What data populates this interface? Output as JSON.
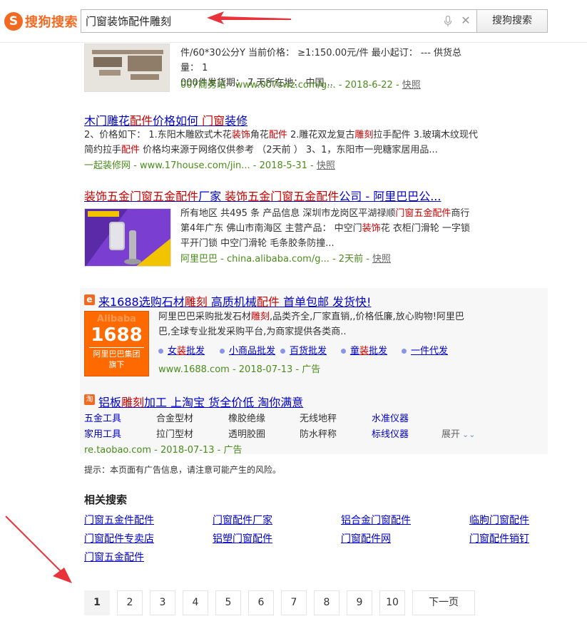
{
  "header": {
    "logo_text": "搜狗搜索",
    "query": "门窗装饰配件雕刻",
    "search_button": "搜狗搜索"
  },
  "result1": {
    "line1": "件/60*30公分Y 当前价格： ≥1:150.00元/件 最小起订： --- 供货总量： 1",
    "line2": "000件发货期： 7 天所在地： 中国...",
    "source": "007商务站 - www.007swz.com/g... - 2018-6-22 - ",
    "snapshot": "快照"
  },
  "result2": {
    "title_parts": [
      "木门雕花",
      "配件",
      "价格如何 ",
      "门窗",
      "装修"
    ],
    "line1_parts": [
      "2、价格如下： 1.东阳木雕欧式木花",
      "装饰",
      "角花",
      "配件",
      " 2.雕花双龙复古",
      "雕刻",
      "拉手",
      "配件",
      " 3.玻璃木纹现代"
    ],
    "line2_parts": [
      "简约拉手",
      "配件",
      " 价格均来源于网络仅供参考 （2天前 ） 3、1，东阳市一兜糖家居用品..."
    ],
    "source": "一起装修网 - www.17house.com/jin... - 2018-5-31 - ",
    "snapshot": "快照"
  },
  "result3": {
    "title_parts": [
      "装饰",
      "五金",
      "门窗",
      "五金",
      "配件",
      "厂家 ",
      "装饰",
      "五金",
      "门窗",
      "五金",
      "配件",
      "公司 - 阿里巴巴公..."
    ],
    "line1_parts": [
      "所有地区 共495 条 产品信息 深圳市龙岗区平湖禄顺",
      "门窗",
      "五金",
      "配件",
      "商行"
    ],
    "line2_parts": [
      "第4年广东 佛山市南海区 主营产品： 中空门",
      "装饰",
      "花 衣柜门滑轮 一字锁"
    ],
    "line3": "平开门锁 中空门滑轮 毛条胶条防撞...",
    "source": "阿里巴巴 - china.alibaba.com/g... - 2天前 - ",
    "snapshot": "快照"
  },
  "ad1": {
    "badge": "e",
    "title_parts": [
      "来1688选购石材",
      "雕刻",
      " 高质机械",
      "配件",
      " 首单包邮 发货快!"
    ],
    "logo_top": "Alibaba",
    "logo_num": "1688",
    "logo_line1": "阿里巴巴集团",
    "logo_line2": "旗下",
    "line1_parts": [
      "阿里巴巴采购批发石材",
      "雕刻",
      ",品类齐全,厂家直销,,价格低廉,放心购物!阿里巴"
    ],
    "line2": "巴,全球专业批发采购平台,为商家提供各类商..",
    "links": [
      {
        "parts": [
          "女",
          "装",
          "批发"
        ]
      },
      {
        "parts": [
          "小商品批发"
        ]
      },
      {
        "parts": [
          "百货批发"
        ]
      },
      {
        "parts": [
          "童",
          "装",
          "批发"
        ]
      },
      {
        "parts": [
          "一件代发"
        ]
      }
    ],
    "source": "www.1688.com - 2018-07-13 - 广告"
  },
  "ad2": {
    "badge": "淘",
    "title_parts": [
      "铝板",
      "雕刻",
      "加工 上淘宝 货全价低 淘你满意"
    ],
    "row1": [
      "五金工具",
      "合金型材",
      "橡胶绝缘",
      "无线地秤",
      "水准仪器"
    ],
    "row2": [
      "家用工具",
      "拉门型材",
      "透明胶圈",
      "防水秤称",
      "标线仪器"
    ],
    "expand": "展开",
    "source": "re.taobao.com - 2018-07-13 - 广告"
  },
  "notice": "提示：本页面有广告信息，请注意可能产生的风险。",
  "related": {
    "title": "相关搜索",
    "items": [
      "门窗五金件配件",
      "门窗配件厂家",
      "铝合金门窗配件",
      "临朐门窗配件",
      "门窗配件专卖店",
      "铝塑门窗配件",
      "门窗配件网",
      "门窗配件销钉",
      "门窗五金配件"
    ]
  },
  "pager": {
    "pages": [
      "1",
      "2",
      "3",
      "4",
      "5",
      "6",
      "7",
      "8",
      "9",
      "10"
    ],
    "next": "下一页"
  },
  "colors": {
    "accent": "#f26a22",
    "link": "#0000cc",
    "highlight": "#cc0000",
    "url": "#4a8c1c",
    "arrow": "#e8333a"
  }
}
